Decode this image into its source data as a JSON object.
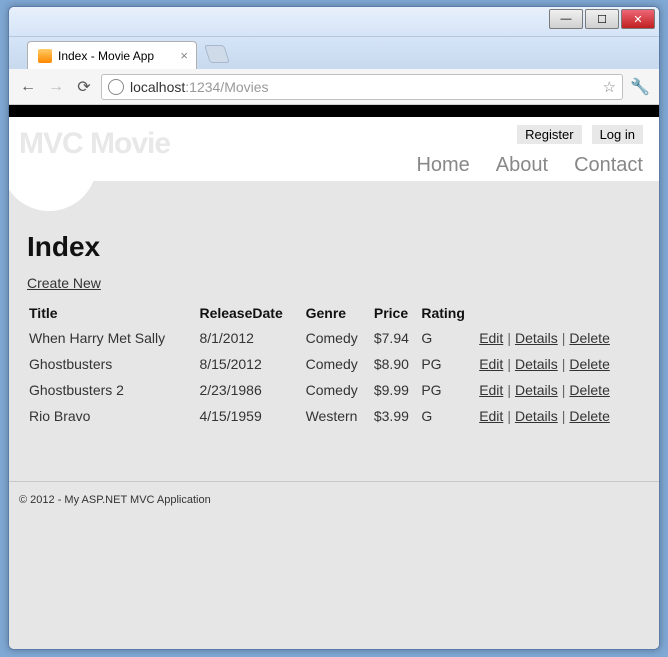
{
  "window": {
    "tab_title": "Index - Movie App",
    "url_host": "localhost",
    "url_rest": ":1234/Movies"
  },
  "header": {
    "site_title": "MVC Movie",
    "meta": {
      "register": "Register",
      "login": "Log in"
    },
    "nav": {
      "home": "Home",
      "about": "About",
      "contact": "Contact"
    }
  },
  "page": {
    "heading": "Index",
    "create_label": "Create New",
    "columns": {
      "title": "Title",
      "releaseDate": "ReleaseDate",
      "genre": "Genre",
      "price": "Price",
      "rating": "Rating"
    },
    "actions": {
      "edit": "Edit",
      "details": "Details",
      "delete": "Delete"
    },
    "rows": [
      {
        "title": "When Harry Met Sally",
        "releaseDate": "8/1/2012",
        "genre": "Comedy",
        "price": "$7.94",
        "rating": "G"
      },
      {
        "title": "Ghostbusters",
        "releaseDate": "8/15/2012",
        "genre": "Comedy",
        "price": "$8.90",
        "rating": "PG"
      },
      {
        "title": "Ghostbusters 2",
        "releaseDate": "2/23/1986",
        "genre": "Comedy",
        "price": "$9.99",
        "rating": "PG"
      },
      {
        "title": "Rio Bravo",
        "releaseDate": "4/15/1959",
        "genre": "Western",
        "price": "$3.99",
        "rating": "G"
      }
    ]
  },
  "footer": {
    "text": "© 2012 - My ASP.NET MVC Application"
  }
}
